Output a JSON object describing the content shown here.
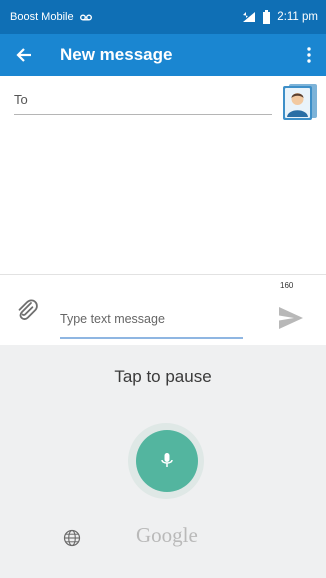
{
  "status_bar": {
    "carrier": "Boost Mobile",
    "time": "2:11 pm"
  },
  "appbar": {
    "title": "New message"
  },
  "recipient": {
    "label": "To"
  },
  "composer": {
    "placeholder": "Type text message",
    "char_count": "160"
  },
  "voice_input": {
    "status": "Tap to pause",
    "provider": "Google"
  },
  "colors": {
    "status_bar": "#0f6fb5",
    "appbar": "#1a86d1",
    "mic_button": "#53b59f",
    "input_underline": "#8fb6e2"
  },
  "icons": {
    "back": "arrow-left-icon",
    "overflow": "more-vert-icon",
    "contact": "contact-card-icon",
    "attach": "paperclip-icon",
    "send": "send-icon",
    "mic": "mic-icon",
    "globe": "globe-icon"
  }
}
